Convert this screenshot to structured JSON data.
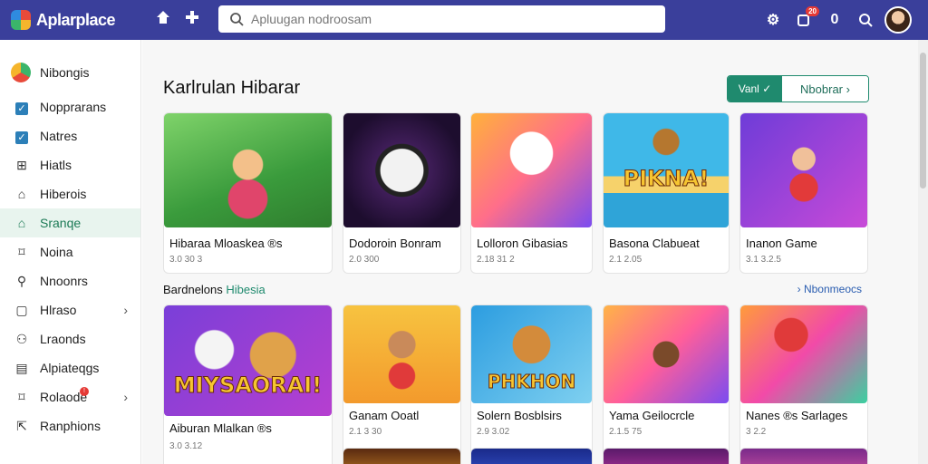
{
  "app": {
    "name": "Aplarplace"
  },
  "topbar": {
    "search_placeholder": "Apluugan nodroosam",
    "notification_count": "20",
    "counter": "0"
  },
  "sidebar": {
    "header": "Nibongis",
    "items": [
      {
        "label": "Nopprarans",
        "icon": "checkbox-icon"
      },
      {
        "label": "Natres",
        "icon": "checkbox-icon"
      },
      {
        "label": "Hiatls",
        "icon": "grid-icon"
      },
      {
        "label": "Hiberois",
        "icon": "home-icon"
      },
      {
        "label": "Sranqe",
        "icon": "home-icon",
        "active": true
      },
      {
        "label": "Noina",
        "icon": "tag-icon"
      },
      {
        "label": "Nnoonrs",
        "icon": "search-icon"
      },
      {
        "label": "Hlraso",
        "icon": "square-icon",
        "chevron": true
      },
      {
        "label": "Lraonds",
        "icon": "people-icon"
      },
      {
        "label": "Alpiateqgs",
        "icon": "document-icon"
      },
      {
        "label": "Rolaode",
        "icon": "tag-icon",
        "chevron": true,
        "badge": "!"
      },
      {
        "label": "Ranphions",
        "icon": "export-icon"
      }
    ]
  },
  "main": {
    "section_title": "Karlrulan Hibarar",
    "segment": {
      "left": "Vanl",
      "right": "Nbobrar"
    },
    "subsection": {
      "title": "Bardnelons",
      "accent": "Hibesia"
    },
    "see_more": "Nbonmeocs",
    "row1": [
      {
        "title": "Hibaraa Mloaskea ®s",
        "meta": "3.0 30 3"
      },
      {
        "title": "Dodoroin Bonram",
        "meta": "2.0 300"
      },
      {
        "title": "Lolloron Gibasias",
        "meta": "2.18 31 2"
      },
      {
        "title": "Basona Clabueat",
        "meta": "2.1 2.05"
      },
      {
        "title": "Inanon Game",
        "meta": "3.1 3.2.5"
      }
    ],
    "row2": [
      {
        "title": "Aiburan Mlalkan ®s",
        "meta": "3.0 3.12",
        "banner": "MIYSAORAI!"
      },
      {
        "title": "Ganam Ooatl",
        "meta": "2.1 3 30"
      },
      {
        "title": "Solern Bosblsirs",
        "meta": "2.9 3.02",
        "banner": "PHKHON"
      },
      {
        "title": "Yama Geilocrcle",
        "meta": "2.1.5 75"
      },
      {
        "title": "Nanes ®s Sarlages",
        "meta": "3 2.2"
      }
    ],
    "thumb_banners": {
      "card4": "PIKNA!"
    }
  },
  "colors": {
    "topbar": "#3a3f9b",
    "accent": "#1f8a6e",
    "link": "#2a5db0"
  }
}
